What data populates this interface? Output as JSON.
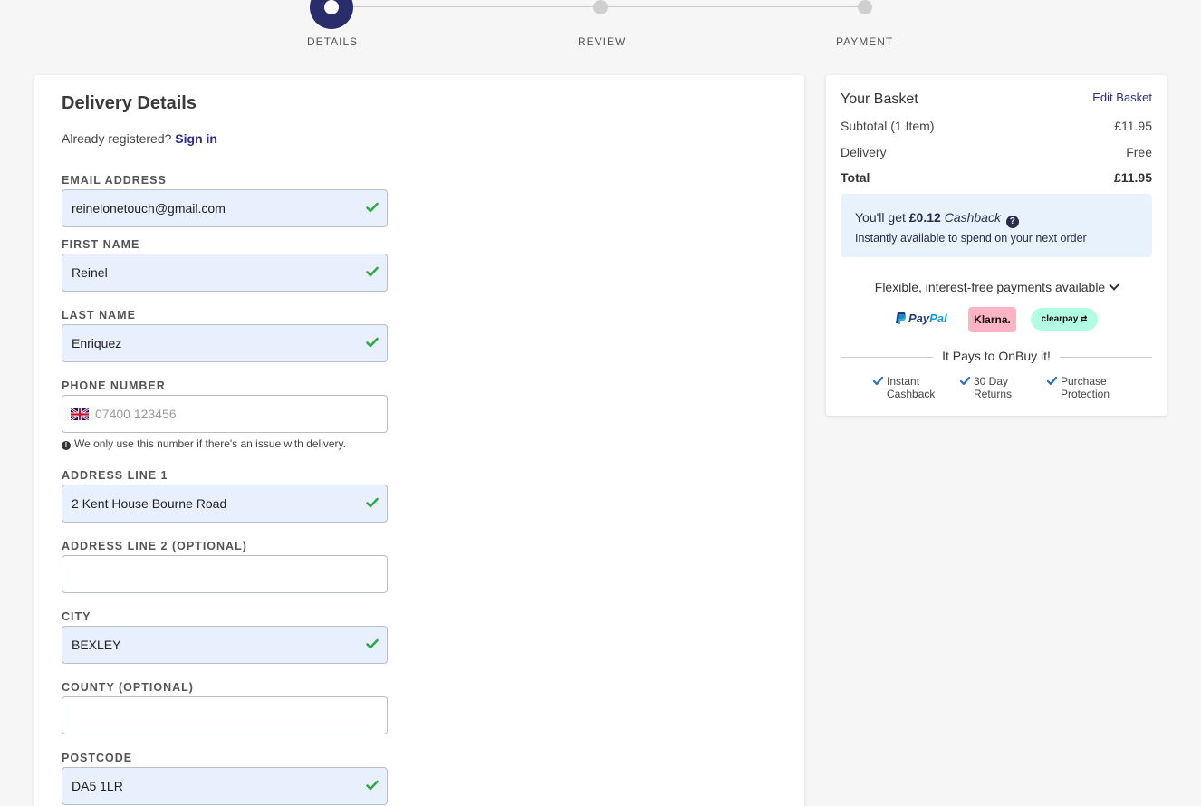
{
  "stepper": {
    "steps": [
      {
        "label": "DETAILS"
      },
      {
        "label": "REVIEW"
      },
      {
        "label": "PAYMENT"
      }
    ]
  },
  "delivery": {
    "title": "Delivery Details",
    "already_registered": "Already registered?",
    "sign_in": "Sign in",
    "fields": {
      "email": {
        "label": "EMAIL ADDRESS",
        "value": "reinelonetouch@gmail.com"
      },
      "first_name": {
        "label": "FIRST NAME",
        "value": "Reinel"
      },
      "last_name": {
        "label": "LAST NAME",
        "value": "Enriquez"
      },
      "phone": {
        "label": "PHONE NUMBER",
        "value": "",
        "placeholder": "07400 123456",
        "hint": "We only use this number if there's an issue with delivery."
      },
      "address1": {
        "label": "ADDRESS LINE 1",
        "value": "2 Kent House Bourne Road"
      },
      "address2": {
        "label": "ADDRESS LINE 2 (OPTIONAL)",
        "value": ""
      },
      "city": {
        "label": "CITY",
        "value": "BEXLEY"
      },
      "county": {
        "label": "COUNTY (OPTIONAL)",
        "value": ""
      },
      "postcode": {
        "label": "POSTCODE",
        "value": "DA5 1LR"
      }
    }
  },
  "basket": {
    "title": "Your Basket",
    "edit": "Edit Basket",
    "subtotal_label": "Subtotal (1 Item)",
    "subtotal_value": "£11.95",
    "delivery_label": "Delivery",
    "delivery_value": "Free",
    "total_label": "Total",
    "total_value": "£11.95",
    "cashback": {
      "prefix": "You'll get",
      "amount": "£0.12",
      "word": "Cashback",
      "subtext": "Instantly available to spend on your next order"
    },
    "flexible": "Flexible, interest-free payments available",
    "logos": {
      "paypal_pay": "Pay",
      "paypal_pal": "Pal",
      "klarna": "Klarna.",
      "clearpay": "clearpay"
    },
    "pays": "It Pays to OnBuy it!",
    "benefits": [
      {
        "line1": "Instant",
        "line2": "Cashback"
      },
      {
        "line1": "30 Day",
        "line2": "Returns"
      },
      {
        "line1": "Purchase",
        "line2": "Protection"
      }
    ]
  },
  "colors": {
    "brand": "#2a2d6b",
    "link": "#2a2d8a",
    "valid": "#2eaa4a",
    "filled_bg": "#e8f0fe"
  }
}
